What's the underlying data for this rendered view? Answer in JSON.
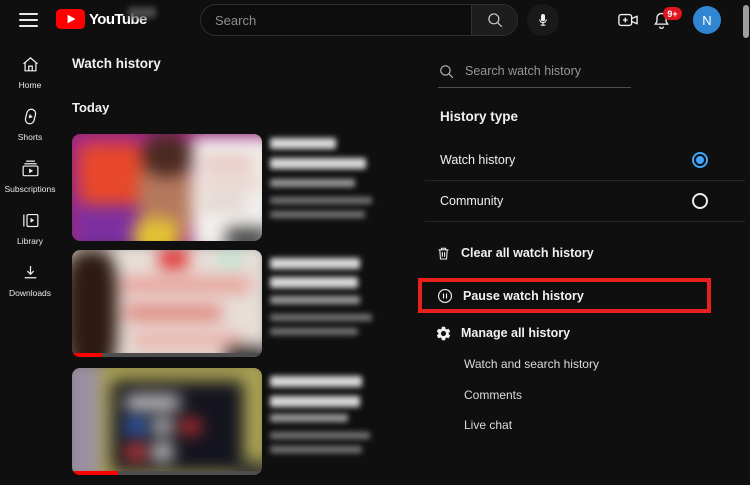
{
  "topbar": {
    "logo_text": "YouTube",
    "search_placeholder": "Search",
    "notification_count": "9+",
    "avatar_initial": "N"
  },
  "sidebar": {
    "items": [
      {
        "icon": "home-icon",
        "label": "Home"
      },
      {
        "icon": "shorts-icon",
        "label": "Shorts"
      },
      {
        "icon": "subscriptions-icon",
        "label": "Subscriptions"
      },
      {
        "icon": "library-icon",
        "label": "Library"
      },
      {
        "icon": "downloads-icon",
        "label": "Downloads"
      }
    ]
  },
  "main": {
    "title": "Watch history",
    "section_label": "Today",
    "videos": [
      {
        "blurred": true,
        "has_progress_bar": false
      },
      {
        "blurred": true,
        "has_progress_bar": true
      },
      {
        "blurred": true,
        "has_progress_bar": true
      }
    ]
  },
  "panel": {
    "search_placeholder": "Search watch history",
    "history_type_title": "History type",
    "options": [
      {
        "label": "Watch history",
        "selected": true
      },
      {
        "label": "Community",
        "selected": false
      }
    ],
    "actions": [
      {
        "icon": "trash-icon",
        "label": "Clear all watch history",
        "highlighted": false
      },
      {
        "icon": "pause-icon",
        "label": "Pause watch history",
        "highlighted": true
      },
      {
        "icon": "gear-icon",
        "label": "Manage all history",
        "highlighted": false
      }
    ],
    "sub_items": [
      {
        "label": "Watch and search history"
      },
      {
        "label": "Comments"
      },
      {
        "label": "Live chat"
      }
    ]
  },
  "icons": {
    "menu-icon": "hamburger ≡",
    "search-icon": "magnifier",
    "mic-icon": "microphone",
    "create-icon": "video-camera-plus",
    "bell-icon": "notification bell",
    "home-icon": "house",
    "shorts-icon": "shorts play",
    "subscriptions-icon": "stacked list play",
    "library-icon": "library play",
    "downloads-icon": "down arrow",
    "trash-icon": "trash can",
    "pause-icon": "circled pause ⏸",
    "gear-icon": "settings gear ⚙",
    "radio-on-icon": "selected radio ◉",
    "radio-off-icon": "radio ○"
  },
  "colors": {
    "background": "#0f0f0f",
    "logo_red": "#ff0000",
    "accent_blue": "#3ea6ff",
    "highlight_box_red": "#e8211f",
    "badge_red": "#e0161f",
    "avatar_blue": "#3086d3"
  }
}
